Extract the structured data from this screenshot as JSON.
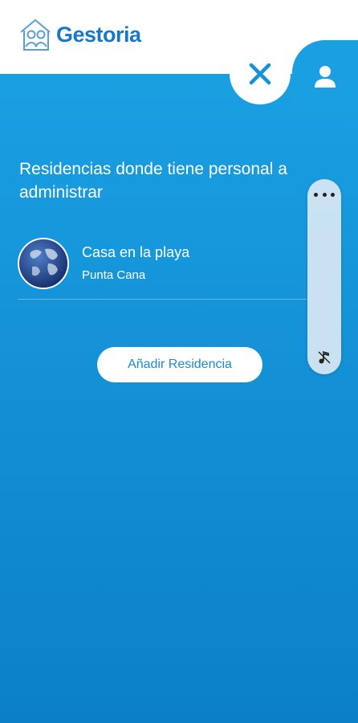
{
  "header": {
    "logo_text": "Gestoria",
    "logo_icon": "house-people-icon"
  },
  "nav": {
    "close_icon": "close-icon",
    "profile_icon": "user-icon"
  },
  "main": {
    "section_title": "Residencias donde tiene personal a administrar",
    "residences": [
      {
        "name": "Casa en la playa",
        "location": "Punta Cana",
        "avatar_icon": "globe-icon"
      }
    ],
    "add_button_label": "Añadir Residencia"
  },
  "floating_bar": {
    "more_icon": "more-dots-icon",
    "music_icon": "music-note-icon"
  },
  "colors": {
    "brand_blue": "#1877c9",
    "background_blue": "#1aa0e2",
    "white": "#ffffff"
  }
}
